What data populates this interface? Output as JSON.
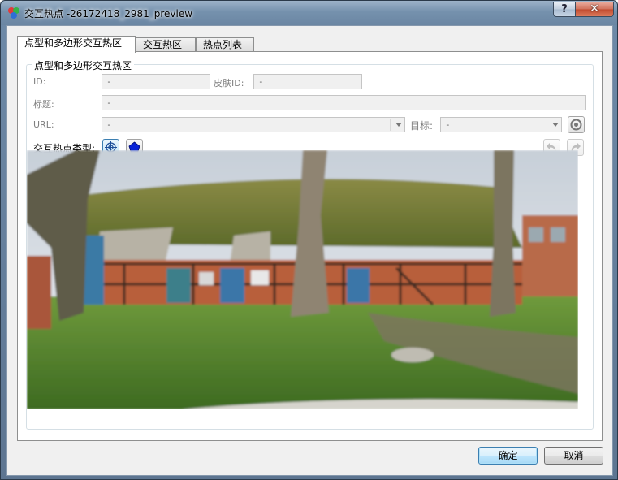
{
  "window": {
    "title": "交互热点 -26172418_2981_preview",
    "help_label": "?",
    "close_label": "✕"
  },
  "tabs": [
    {
      "label": "点型和多边形交互热区",
      "active": true
    },
    {
      "label": "交互热区",
      "active": false
    },
    {
      "label": "热点列表",
      "active": false
    }
  ],
  "group": {
    "title": "点型和多边形交互热区"
  },
  "form": {
    "id_label": "ID:",
    "id_value": "-",
    "skin_id_label": "皮肤ID:",
    "skin_id_value": "-",
    "title_label": "标题:",
    "title_value": "-",
    "url_label": "URL:",
    "url_value": "-",
    "target_label": "目标:",
    "target_value": "-",
    "hotspot_type_label": "交互热点类型:"
  },
  "icons": {
    "app": "app-icon",
    "point": "crosshair-icon",
    "polygon": "pentagon-icon",
    "target_picker": "circle-target-icon",
    "undo": "undo-icon",
    "redo": "redo-icon"
  },
  "colors": {
    "accent": "#3c7fb1",
    "polygon_icon": "#0a24d6"
  },
  "buttons": {
    "ok": "确定",
    "cancel": "取消"
  }
}
